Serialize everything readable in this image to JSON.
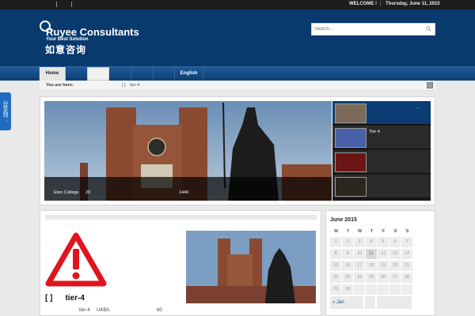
{
  "topbar": {
    "welcome": "WELCOME !",
    "divider": "|",
    "date": "Thursday, June 11, 2015"
  },
  "header": {
    "brand": "Ruyee Consultants",
    "slogan": "Your Best Solution",
    "brand_cn": "如意咨询"
  },
  "search": {
    "placeholder": "Search..."
  },
  "nav": {
    "home": "Home",
    "english": "English"
  },
  "breadcrumb": {
    "label": "You are here:",
    "sep": "[ ]",
    "current": "tier-4"
  },
  "share": {
    "label": "分享到："
  },
  "slider": {
    "caption": {
      "place": "Eton College",
      "num1": "20",
      "num2": "1440"
    },
    "thumbs": [
      {
        "text": "..."
      },
      {
        "text": "Tier 4"
      },
      {
        "text": ""
      },
      {
        "text": ""
      }
    ]
  },
  "post": {
    "title_brackets": "[ ]",
    "title": "tier-4",
    "meta": {
      "tag": "tier-4",
      "org": "UKBA",
      "count": "60"
    }
  },
  "calendar": {
    "title": "June 2015",
    "weekdays": [
      "M",
      "T",
      "W",
      "T",
      "F",
      "S",
      "S"
    ],
    "today": "11",
    "prev": "« Jan",
    "weeks": [
      [
        "1",
        "2",
        "3",
        "4",
        "5",
        "6",
        "7"
      ],
      [
        "8",
        "9",
        "10",
        "11",
        "12",
        "13",
        "14"
      ],
      [
        "15",
        "16",
        "17",
        "18",
        "19",
        "20",
        "21"
      ],
      [
        "22",
        "23",
        "24",
        "25",
        "26",
        "27",
        "28"
      ],
      [
        "29",
        "30",
        "",
        "",
        "",
        "",
        ""
      ]
    ]
  },
  "colors": {
    "header_bg": "#083a6e",
    "topbar_bg": "#1d1d1d",
    "warning_red": "#e0141e",
    "link_blue": "#1a4f8a"
  }
}
